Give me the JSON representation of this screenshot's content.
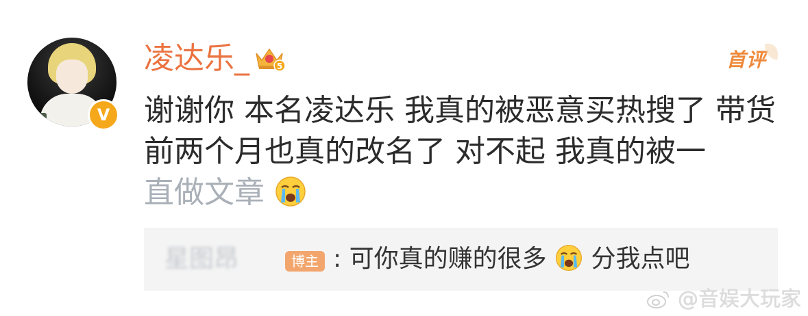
{
  "comment": {
    "username": "凌达乐_",
    "level_badge": "5",
    "verified_badge": "V",
    "first_comment_tag": "首评",
    "body_main": "谢谢你 本名凌达乐 我真的被恶意买热搜了 带货前两个月也真的改名了 对不起 我真的被一",
    "body_faded": "直做文章",
    "emoji": "cry-emoji"
  },
  "reply": {
    "author": "星图昂",
    "author_badge": "博主",
    "text_before_emoji": ": 可你真的赚的很多",
    "text_after_emoji": "分我点吧"
  },
  "watermark": {
    "text": "@音娱大玩家"
  },
  "colors": {
    "username": "#eb7340",
    "first_comment_tag": "#ee8a3c",
    "verified_badge": "#f6a81b",
    "reply_background": "#f4f4f4",
    "author_badge": "#f2a66d"
  }
}
